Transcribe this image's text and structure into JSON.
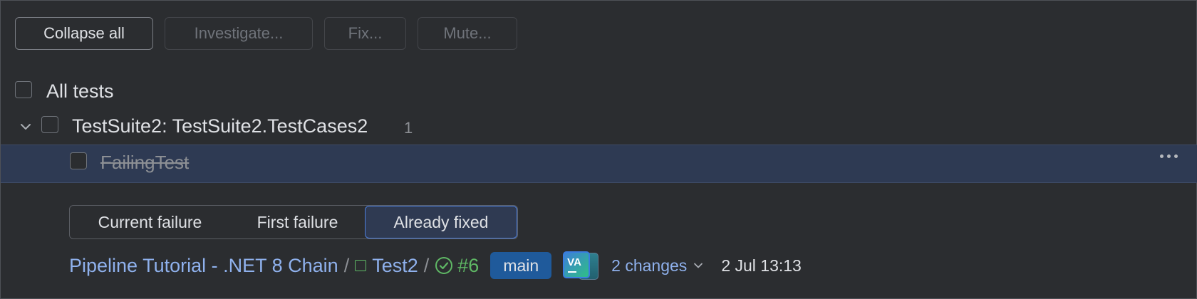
{
  "toolbar": {
    "collapse_label": "Collapse all",
    "investigate_label": "Investigate...",
    "fix_label": "Fix...",
    "mute_label": "Mute..."
  },
  "tree": {
    "all_label": "All tests",
    "suite_label": "TestSuite2: TestSuite2.TestCases2",
    "suite_count": "1",
    "test_label": "FailingTest"
  },
  "tabs": {
    "current": "Current failure",
    "first": "First failure",
    "fixed": "Already fixed"
  },
  "build": {
    "pipeline": "Pipeline Tutorial - .NET 8 Chain",
    "sep": "/",
    "job": "Test2",
    "number": "#6",
    "branch": "main",
    "avatar_initials": "VA",
    "changes": "2 changes",
    "date": "2 Jul 13:13"
  },
  "colors": {
    "accent": "#4d7fdc",
    "success": "#5fb865",
    "link": "#8fb1ed"
  },
  "icons": [
    "chevron-down-icon",
    "more-icon",
    "build-config-icon",
    "success-icon"
  ]
}
